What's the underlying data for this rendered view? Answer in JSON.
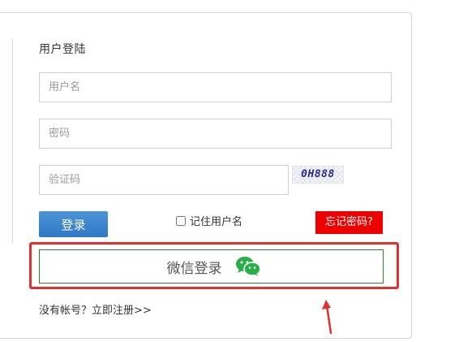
{
  "form": {
    "title": "用户登陆",
    "username_placeholder": "用户名",
    "password_placeholder": "密码",
    "captcha_placeholder": "验证码",
    "captcha_text": "0H888",
    "login_label": "登录",
    "remember_label": "记住用户名",
    "forgot_label": "忘记密码?",
    "wechat_label": "微信登录",
    "register_text": "没有帐号？立即注册>>"
  },
  "colors": {
    "login_button": "#2f78c4",
    "forgot_button": "#ee0000",
    "wechat_border": "#2e7d32",
    "wechat_icon": "#2aae4a",
    "highlight": "#e03030"
  },
  "icons": {
    "wechat": "wechat-icon",
    "annotation": "red-arrow-icon"
  }
}
